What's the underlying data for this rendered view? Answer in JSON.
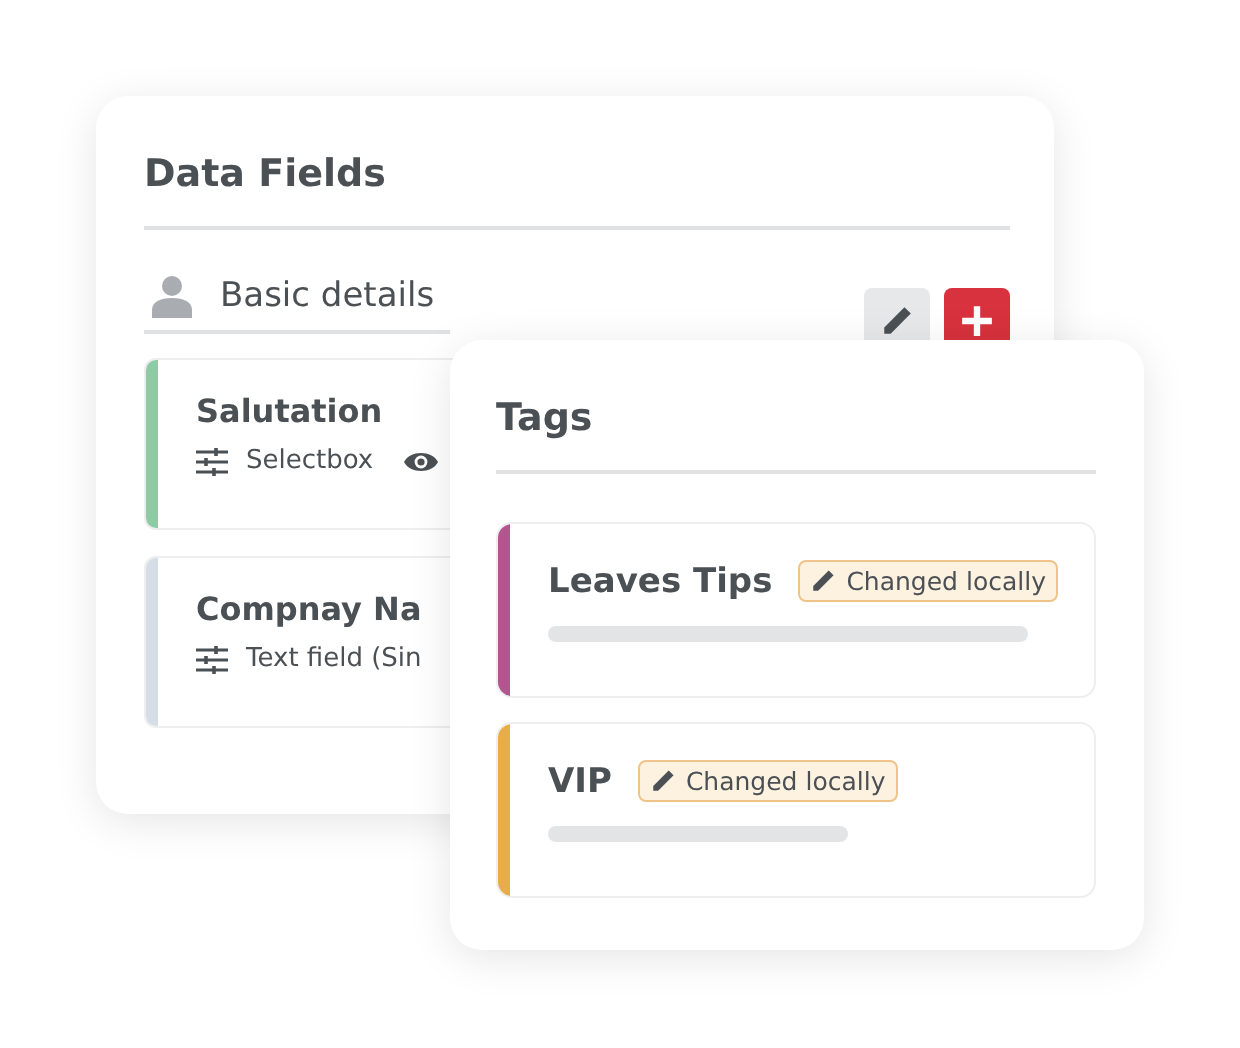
{
  "data_fields": {
    "title": "Data Fields",
    "section": {
      "title": "Basic details"
    },
    "fields": [
      {
        "name": "Salutation",
        "type": "Selectbox",
        "color": "#8fcaa4",
        "visible_icon": true
      },
      {
        "name": "Compnay Na",
        "type": "Text field (Sin",
        "color": "#d5dde6"
      }
    ]
  },
  "tags": {
    "title": "Tags",
    "items": [
      {
        "name": "Leaves Tips",
        "badge": "Changed locally",
        "color": "#b5558f"
      },
      {
        "name": "VIP",
        "badge": "Changed locally",
        "color": "#e9ad47"
      }
    ]
  }
}
